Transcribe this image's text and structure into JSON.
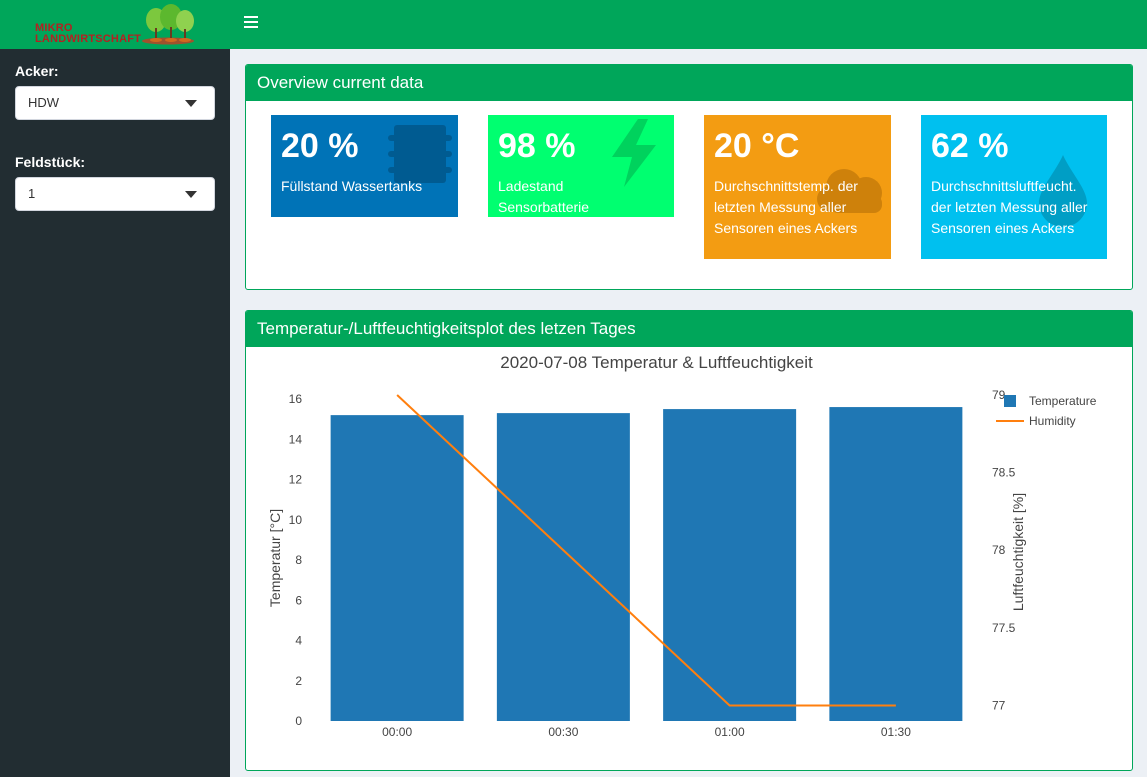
{
  "sidebar": {
    "logo_line1": "MIKRO",
    "logo_line2": "LANDWIRTSCHAFT",
    "acker_label": "Acker:",
    "acker_value": "HDW",
    "feld_label": "Feldstück:",
    "feld_value": "1"
  },
  "overview": {
    "title": "Overview current data",
    "boxes": [
      {
        "value": "20 %",
        "subtitle": "Füllstand Wassertanks",
        "color": "#0073b7",
        "icon": "water-tank-icon"
      },
      {
        "value": "98 %",
        "subtitle": "Ladestand Sensorbatterie",
        "color": "#00ff70",
        "icon": "lightning-icon"
      },
      {
        "value": "20 °C",
        "subtitle": "Durchschnittstemp. der letzten Messung aller Sensoren eines Ackers",
        "color": "#f39c12",
        "icon": "cloud-icon"
      },
      {
        "value": "62 %",
        "subtitle": "Durchschnittsluftfeucht. der letzten Messung aller Sensoren eines Ackers",
        "color": "#00c0ef",
        "icon": "droplet-icon"
      }
    ]
  },
  "plot_box": {
    "title": "Temperatur-/Luftfeuchtigkeitsplot des letzen Tages"
  },
  "chart_data": {
    "type": "bar",
    "title": "2020-07-08 Temperatur & Luftfeuchtigkeit",
    "categories": [
      "00:00",
      "00:30",
      "01:00",
      "01:30"
    ],
    "series": [
      {
        "name": "Temperature",
        "type": "bar",
        "axis": "left",
        "values": [
          15.2,
          15.3,
          15.5,
          15.6
        ],
        "color": "#1f77b4"
      },
      {
        "name": "Humidity",
        "type": "line",
        "axis": "right",
        "values": [
          79.0,
          78.0,
          77.0,
          77.0
        ],
        "color": "#ff7f0e"
      }
    ],
    "ylabel": "Temperatur [°C]",
    "y2label": "Luftfeuchtigkeit [%]",
    "ylim": [
      0,
      16.2
    ],
    "y_ticks": [
      0,
      2,
      4,
      6,
      8,
      10,
      12,
      14,
      16
    ],
    "y2lim": [
      76.9,
      79.0
    ],
    "y2_ticks": [
      "77",
      "77.5",
      "78",
      "78.5",
      "79"
    ],
    "legend_position": "top-right",
    "grid": false
  }
}
